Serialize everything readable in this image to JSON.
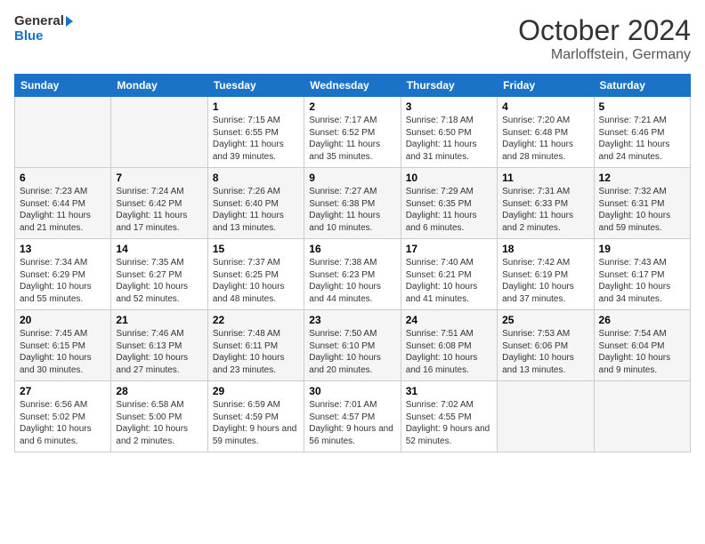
{
  "header": {
    "logo_line1": "General",
    "logo_line2": "Blue",
    "month": "October 2024",
    "location": "Marloffstein, Germany"
  },
  "days_of_week": [
    "Sunday",
    "Monday",
    "Tuesday",
    "Wednesday",
    "Thursday",
    "Friday",
    "Saturday"
  ],
  "weeks": [
    [
      {
        "day": "",
        "info": ""
      },
      {
        "day": "",
        "info": ""
      },
      {
        "day": "1",
        "info": "Sunrise: 7:15 AM\nSunset: 6:55 PM\nDaylight: 11 hours and 39 minutes."
      },
      {
        "day": "2",
        "info": "Sunrise: 7:17 AM\nSunset: 6:52 PM\nDaylight: 11 hours and 35 minutes."
      },
      {
        "day": "3",
        "info": "Sunrise: 7:18 AM\nSunset: 6:50 PM\nDaylight: 11 hours and 31 minutes."
      },
      {
        "day": "4",
        "info": "Sunrise: 7:20 AM\nSunset: 6:48 PM\nDaylight: 11 hours and 28 minutes."
      },
      {
        "day": "5",
        "info": "Sunrise: 7:21 AM\nSunset: 6:46 PM\nDaylight: 11 hours and 24 minutes."
      }
    ],
    [
      {
        "day": "6",
        "info": "Sunrise: 7:23 AM\nSunset: 6:44 PM\nDaylight: 11 hours and 21 minutes."
      },
      {
        "day": "7",
        "info": "Sunrise: 7:24 AM\nSunset: 6:42 PM\nDaylight: 11 hours and 17 minutes."
      },
      {
        "day": "8",
        "info": "Sunrise: 7:26 AM\nSunset: 6:40 PM\nDaylight: 11 hours and 13 minutes."
      },
      {
        "day": "9",
        "info": "Sunrise: 7:27 AM\nSunset: 6:38 PM\nDaylight: 11 hours and 10 minutes."
      },
      {
        "day": "10",
        "info": "Sunrise: 7:29 AM\nSunset: 6:35 PM\nDaylight: 11 hours and 6 minutes."
      },
      {
        "day": "11",
        "info": "Sunrise: 7:31 AM\nSunset: 6:33 PM\nDaylight: 11 hours and 2 minutes."
      },
      {
        "day": "12",
        "info": "Sunrise: 7:32 AM\nSunset: 6:31 PM\nDaylight: 10 hours and 59 minutes."
      }
    ],
    [
      {
        "day": "13",
        "info": "Sunrise: 7:34 AM\nSunset: 6:29 PM\nDaylight: 10 hours and 55 minutes."
      },
      {
        "day": "14",
        "info": "Sunrise: 7:35 AM\nSunset: 6:27 PM\nDaylight: 10 hours and 52 minutes."
      },
      {
        "day": "15",
        "info": "Sunrise: 7:37 AM\nSunset: 6:25 PM\nDaylight: 10 hours and 48 minutes."
      },
      {
        "day": "16",
        "info": "Sunrise: 7:38 AM\nSunset: 6:23 PM\nDaylight: 10 hours and 44 minutes."
      },
      {
        "day": "17",
        "info": "Sunrise: 7:40 AM\nSunset: 6:21 PM\nDaylight: 10 hours and 41 minutes."
      },
      {
        "day": "18",
        "info": "Sunrise: 7:42 AM\nSunset: 6:19 PM\nDaylight: 10 hours and 37 minutes."
      },
      {
        "day": "19",
        "info": "Sunrise: 7:43 AM\nSunset: 6:17 PM\nDaylight: 10 hours and 34 minutes."
      }
    ],
    [
      {
        "day": "20",
        "info": "Sunrise: 7:45 AM\nSunset: 6:15 PM\nDaylight: 10 hours and 30 minutes."
      },
      {
        "day": "21",
        "info": "Sunrise: 7:46 AM\nSunset: 6:13 PM\nDaylight: 10 hours and 27 minutes."
      },
      {
        "day": "22",
        "info": "Sunrise: 7:48 AM\nSunset: 6:11 PM\nDaylight: 10 hours and 23 minutes."
      },
      {
        "day": "23",
        "info": "Sunrise: 7:50 AM\nSunset: 6:10 PM\nDaylight: 10 hours and 20 minutes."
      },
      {
        "day": "24",
        "info": "Sunrise: 7:51 AM\nSunset: 6:08 PM\nDaylight: 10 hours and 16 minutes."
      },
      {
        "day": "25",
        "info": "Sunrise: 7:53 AM\nSunset: 6:06 PM\nDaylight: 10 hours and 13 minutes."
      },
      {
        "day": "26",
        "info": "Sunrise: 7:54 AM\nSunset: 6:04 PM\nDaylight: 10 hours and 9 minutes."
      }
    ],
    [
      {
        "day": "27",
        "info": "Sunrise: 6:56 AM\nSunset: 5:02 PM\nDaylight: 10 hours and 6 minutes."
      },
      {
        "day": "28",
        "info": "Sunrise: 6:58 AM\nSunset: 5:00 PM\nDaylight: 10 hours and 2 minutes."
      },
      {
        "day": "29",
        "info": "Sunrise: 6:59 AM\nSunset: 4:59 PM\nDaylight: 9 hours and 59 minutes."
      },
      {
        "day": "30",
        "info": "Sunrise: 7:01 AM\nSunset: 4:57 PM\nDaylight: 9 hours and 56 minutes."
      },
      {
        "day": "31",
        "info": "Sunrise: 7:02 AM\nSunset: 4:55 PM\nDaylight: 9 hours and 52 minutes."
      },
      {
        "day": "",
        "info": ""
      },
      {
        "day": "",
        "info": ""
      }
    ]
  ]
}
